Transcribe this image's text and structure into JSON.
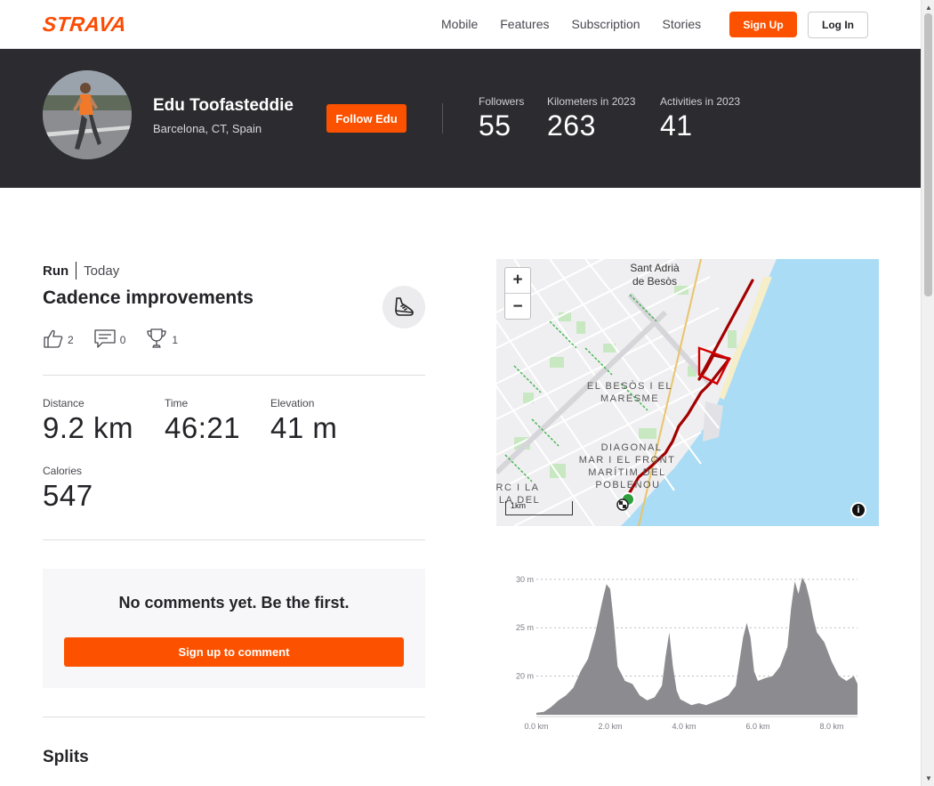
{
  "brand": {
    "logo": "STRAVA",
    "accent": "#fc5200"
  },
  "nav": {
    "links": [
      "Mobile",
      "Features",
      "Subscription",
      "Stories"
    ],
    "signup_label": "Sign Up",
    "login_label": "Log In"
  },
  "athlete": {
    "name": "Edu Toofasteddie",
    "location": "Barcelona, CT, Spain",
    "follow_label": "Follow Edu",
    "stats": [
      {
        "label": "Followers",
        "value": "55"
      },
      {
        "label": "Kilometers in 2023",
        "value": "263"
      },
      {
        "label": "Activities in 2023",
        "value": "41"
      }
    ]
  },
  "activity": {
    "type": "Run",
    "date": "Today",
    "title": "Cadence improvements",
    "kudos_count": "2",
    "comments_count": "0",
    "achievements_count": "1",
    "metrics": [
      {
        "label": "Distance",
        "value": "9.2 km"
      },
      {
        "label": "Time",
        "value": "46:21"
      },
      {
        "label": "Elevation",
        "value": "41 m"
      },
      {
        "label": "Calories",
        "value": "547"
      }
    ]
  },
  "comments": {
    "empty_message": "No comments yet. Be the first.",
    "signup_label": "Sign up to comment"
  },
  "splits": {
    "title": "Splits"
  },
  "map": {
    "zoom_in": "+",
    "zoom_out": "−",
    "scale_label": "1km",
    "labels": [
      "Sant Adrià",
      "de Besòs",
      "EL BESÒS I EL",
      "MARESME",
      "DIAGONAL",
      "MAR I EL FRONT",
      "MARÍTIM DEL",
      "POBLENOU",
      "RC I LA",
      "LA DEL"
    ],
    "info_icon": "info-icon"
  },
  "chart_data": {
    "type": "area",
    "x_ticks": [
      "0.0 km",
      "2.0 km",
      "4.0 km",
      "6.0 km",
      "8.0 km"
    ],
    "y_ticks": [
      "30 m",
      "25 m",
      "20 m"
    ],
    "ylim": [
      16,
      31
    ],
    "xlim": [
      0,
      8.7
    ],
    "x": [
      0,
      0.2,
      0.4,
      0.6,
      0.8,
      1.0,
      1.2,
      1.4,
      1.6,
      1.8,
      1.9,
      2.0,
      2.1,
      2.2,
      2.4,
      2.6,
      2.8,
      3.0,
      3.2,
      3.4,
      3.5,
      3.6,
      3.7,
      3.8,
      3.9,
      4.0,
      4.2,
      4.4,
      4.6,
      4.8,
      5.0,
      5.2,
      5.4,
      5.5,
      5.6,
      5.7,
      5.8,
      5.9,
      6.0,
      6.2,
      6.4,
      6.6,
      6.8,
      6.9,
      7.0,
      7.1,
      7.2,
      7.3,
      7.4,
      7.5,
      7.6,
      7.8,
      8.0,
      8.2,
      8.4,
      8.6,
      8.7
    ],
    "y": [
      16.2,
      16.3,
      16.8,
      17.5,
      18.0,
      18.8,
      20.5,
      21.8,
      24.5,
      28.0,
      29.5,
      29.0,
      25.5,
      21.0,
      19.5,
      19.2,
      18.0,
      17.5,
      17.8,
      19.0,
      22.0,
      24.5,
      21.0,
      18.5,
      17.6,
      17.4,
      17.0,
      17.2,
      17.0,
      17.3,
      17.6,
      18.0,
      19.0,
      21.5,
      24.0,
      25.5,
      24.0,
      20.5,
      19.5,
      19.8,
      20.0,
      21.0,
      23.0,
      27.0,
      29.8,
      28.5,
      30.2,
      29.5,
      28.0,
      26.0,
      24.5,
      23.5,
      21.5,
      20.0,
      19.5,
      20.0,
      19.2
    ]
  }
}
